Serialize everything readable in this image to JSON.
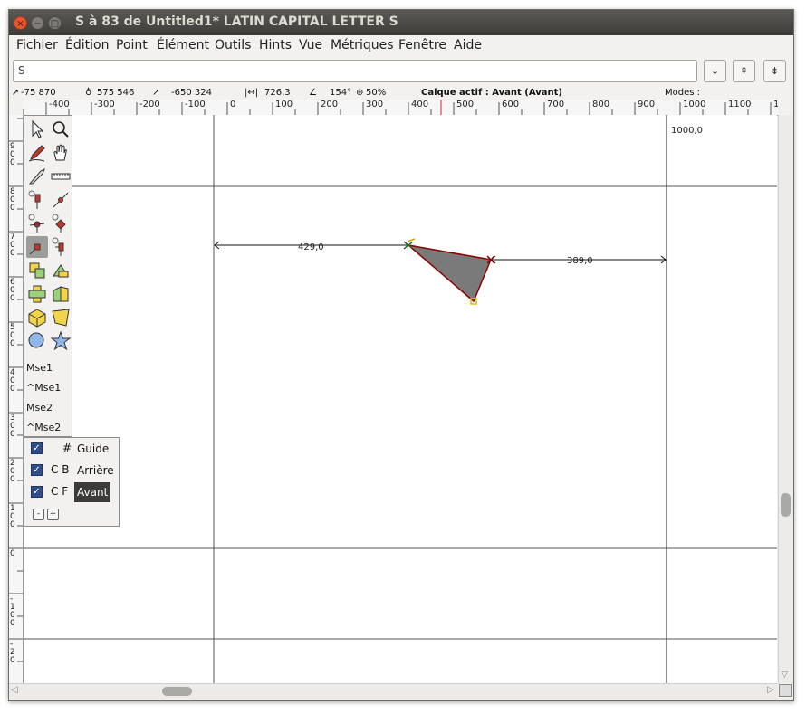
{
  "window": {
    "title": "S à 83 de Untitled1* LATIN CAPITAL LETTER S",
    "close_icon": "×",
    "min_icon": "−",
    "max_icon": "□"
  },
  "menu": [
    "Fichier",
    "Édition",
    "Point",
    "Élément",
    "Outils",
    "Hints",
    "Vue",
    "Métriques",
    "Fenêtre",
    "Aide"
  ],
  "glyph_input": {
    "value": "S"
  },
  "toolbar_buttons": {
    "dropdown": "⌄",
    "prev": "⇞",
    "next": "⇟"
  },
  "infobar": {
    "pos_x": "-75 870",
    "pos_y": "575 546",
    "delta": "-650 324",
    "dist": "726,3",
    "angle": "154°",
    "zoom": "50%",
    "active_layer": "Calque actif : Avant (Avant)",
    "modes": "Modes :"
  },
  "ruler_h": [
    "-400",
    "-300",
    "-200",
    "-100",
    "0",
    "100",
    "200",
    "300",
    "400",
    "500",
    "600",
    "700",
    "800",
    "900",
    "1000",
    "1100",
    "120"
  ],
  "ruler_v": [
    "9\n0\n0",
    "8\n0\n0",
    "7\n0\n0",
    "6\n0\n0",
    "5\n0\n0",
    "4\n0\n0",
    "3\n0\n0",
    "2\n0\n0",
    "1\n0\n0",
    "0",
    "-\n1\n0\n0",
    "-\n2\n0"
  ],
  "canvas": {
    "advance_label": "1000,0",
    "left_measure": "429,0",
    "right_measure": "389,0"
  },
  "toolbox": {
    "mouse_labels": [
      "Mse1",
      "^Mse1",
      "Mse2",
      "^Mse2"
    ]
  },
  "layers": [
    {
      "key": "#",
      "name": "Guide",
      "checked": "✓"
    },
    {
      "key": "C B",
      "name": "Arrière",
      "checked": "✓"
    },
    {
      "key": "C F",
      "name": "Avant",
      "checked": "✓"
    }
  ],
  "layer_buttons": {
    "remove": "-",
    "add": "+"
  },
  "colors": {
    "fill": "#7a7a7a",
    "contour": "#8b0000",
    "guide": "#333333",
    "titlebar": "#3d3c38"
  }
}
